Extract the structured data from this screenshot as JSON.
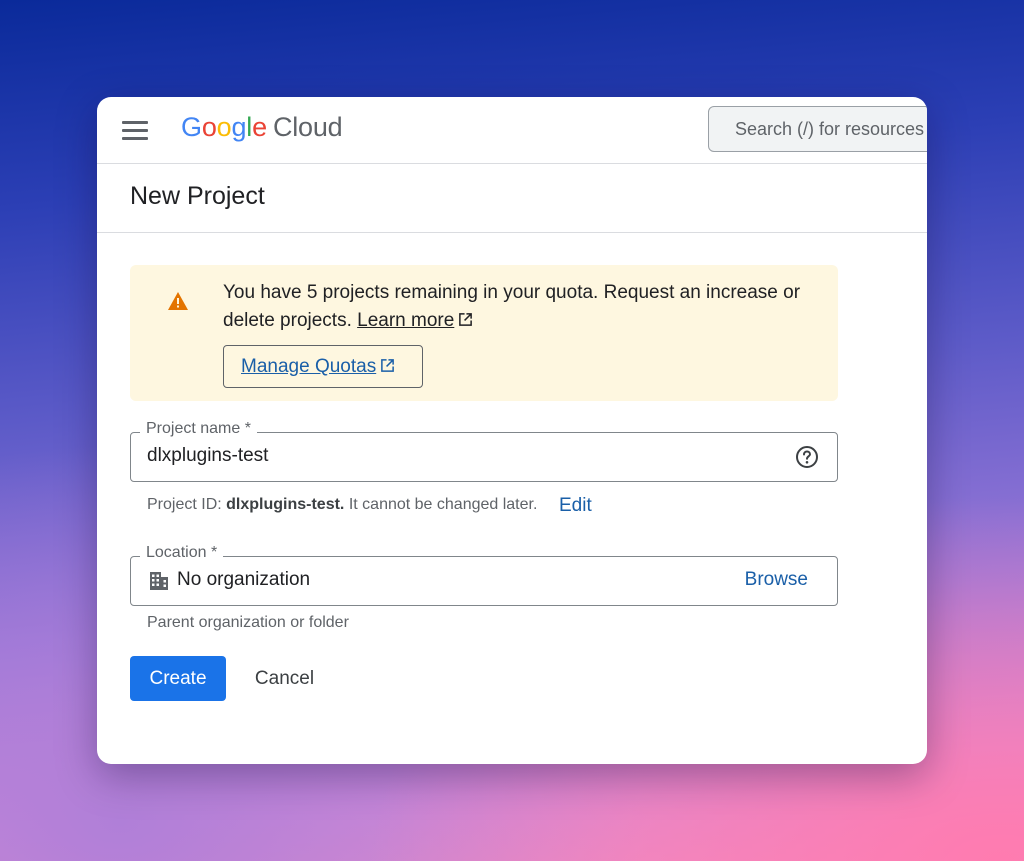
{
  "header": {
    "logo": {
      "letters": [
        {
          "char": "G",
          "color": "#4285F4"
        },
        {
          "char": "o",
          "color": "#EA4335"
        },
        {
          "char": "o",
          "color": "#FBBC05"
        },
        {
          "char": "g",
          "color": "#4285F4"
        },
        {
          "char": "l",
          "color": "#34A853"
        },
        {
          "char": "e",
          "color": "#EA4335"
        }
      ],
      "product": "Cloud"
    },
    "search_placeholder": "Search (/) for resources"
  },
  "page": {
    "title": "New Project"
  },
  "quota_banner": {
    "message": "You have 5 projects remaining in your quota. Request an increase or delete projects.",
    "learn_more": "Learn more",
    "manage_button": "Manage Quotas",
    "icon": "warning-icon",
    "background": "#fef7e0"
  },
  "project_name_field": {
    "label": "Project name *",
    "value": "dlxplugins-test",
    "icon": "help-icon"
  },
  "project_id_hint": {
    "prefix": "Project ID:",
    "id": "dlxplugins-test.",
    "suffix": "It cannot be changed later.",
    "edit_label": "Edit"
  },
  "location_field": {
    "label": "Location *",
    "value": "No organization",
    "icon": "building-icon",
    "browse_label": "Browse",
    "hint": "Parent organization or folder"
  },
  "actions": {
    "create_label": "Create",
    "cancel_label": "Cancel"
  },
  "colors": {
    "primary": "#1a73e8",
    "link": "#1a5fa8",
    "warning": "#e37400"
  }
}
